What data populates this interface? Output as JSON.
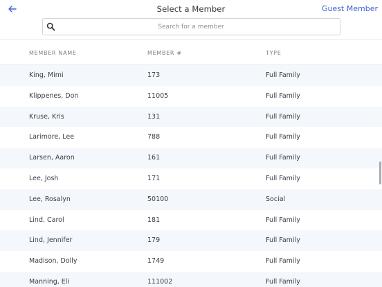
{
  "header": {
    "title": "Select a Member",
    "guest_label": "Guest Member"
  },
  "search": {
    "placeholder": "Search for a member",
    "value": ""
  },
  "table": {
    "columns": [
      "MEMBER NAME",
      "MEMBER #",
      "TYPE"
    ],
    "rows": [
      {
        "name": "King, Mimi",
        "number": "173",
        "type": "Full Family"
      },
      {
        "name": "Klippenes, Don",
        "number": "11005",
        "type": "Full Family"
      },
      {
        "name": "Kruse, Kris",
        "number": "131",
        "type": "Full Family"
      },
      {
        "name": "Larimore, Lee",
        "number": "788",
        "type": "Full Family"
      },
      {
        "name": "Larsen, Aaron",
        "number": "161",
        "type": "Full Family"
      },
      {
        "name": "Lee, Josh",
        "number": "171",
        "type": "Full Family"
      },
      {
        "name": "Lee, Rosalyn",
        "number": "50100",
        "type": "Social"
      },
      {
        "name": "Lind, Carol",
        "number": "181",
        "type": "Full Family"
      },
      {
        "name": "Lind, Jennifer",
        "number": "179",
        "type": "Full Family"
      },
      {
        "name": "Madison, Dolly",
        "number": "1749",
        "type": "Full Family"
      },
      {
        "name": "Manning, Eli",
        "number": "111002",
        "type": "Full Family"
      }
    ]
  },
  "colors": {
    "accent": "#3d63d6",
    "row_stripe": "#f4f8fc",
    "header_text": "#7b7f86"
  },
  "icons": {
    "back": "arrow-left-icon",
    "search": "search-icon"
  }
}
